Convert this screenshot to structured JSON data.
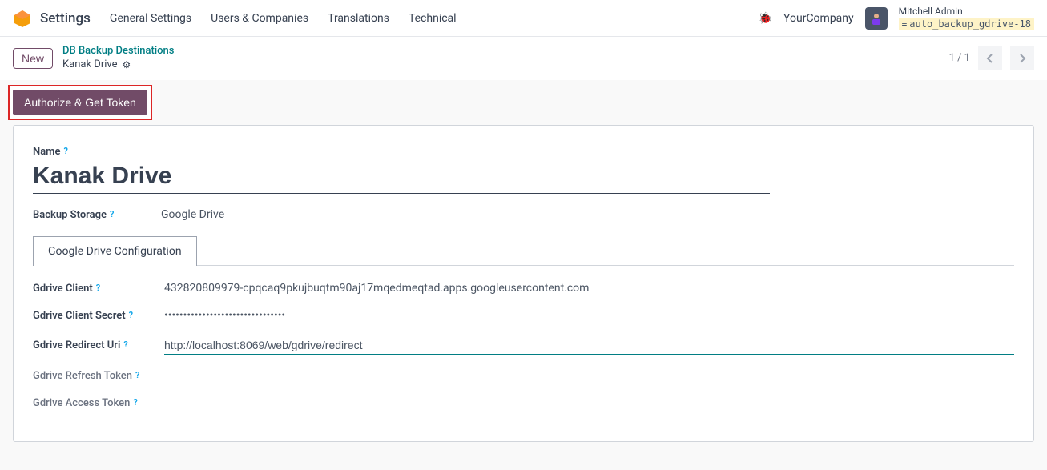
{
  "navbar": {
    "app_name": "Settings",
    "menu": [
      "General Settings",
      "Users & Companies",
      "Translations",
      "Technical"
    ],
    "company": "YourCompany",
    "user_name": "Mitchell Admin",
    "db_name": "auto_backup_gdrive-18"
  },
  "breadcrumb": {
    "new_label": "New",
    "parent": "DB Backup Destinations",
    "current": "Kanak Drive",
    "pager": "1 / 1"
  },
  "action": {
    "authorize_label": "Authorize & Get Token"
  },
  "form": {
    "name_label": "Name",
    "name_value": "Kanak Drive",
    "storage_label": "Backup Storage",
    "storage_value": "Google Drive",
    "tab_label": "Google Drive Configuration",
    "client_label": "Gdrive Client",
    "client_value": "432820809979-cpqcaq9pkujbuqtm90aj17mqedmeqtad.apps.googleusercontent.com",
    "secret_label": "Gdrive Client Secret",
    "secret_value": "••••••••••••••••••••••••••••••••",
    "redirect_label": "Gdrive Redirect Uri",
    "redirect_value": "http://localhost:8069/web/gdrive/redirect",
    "refresh_label": "Gdrive Refresh Token",
    "access_label": "Gdrive Access Token"
  }
}
